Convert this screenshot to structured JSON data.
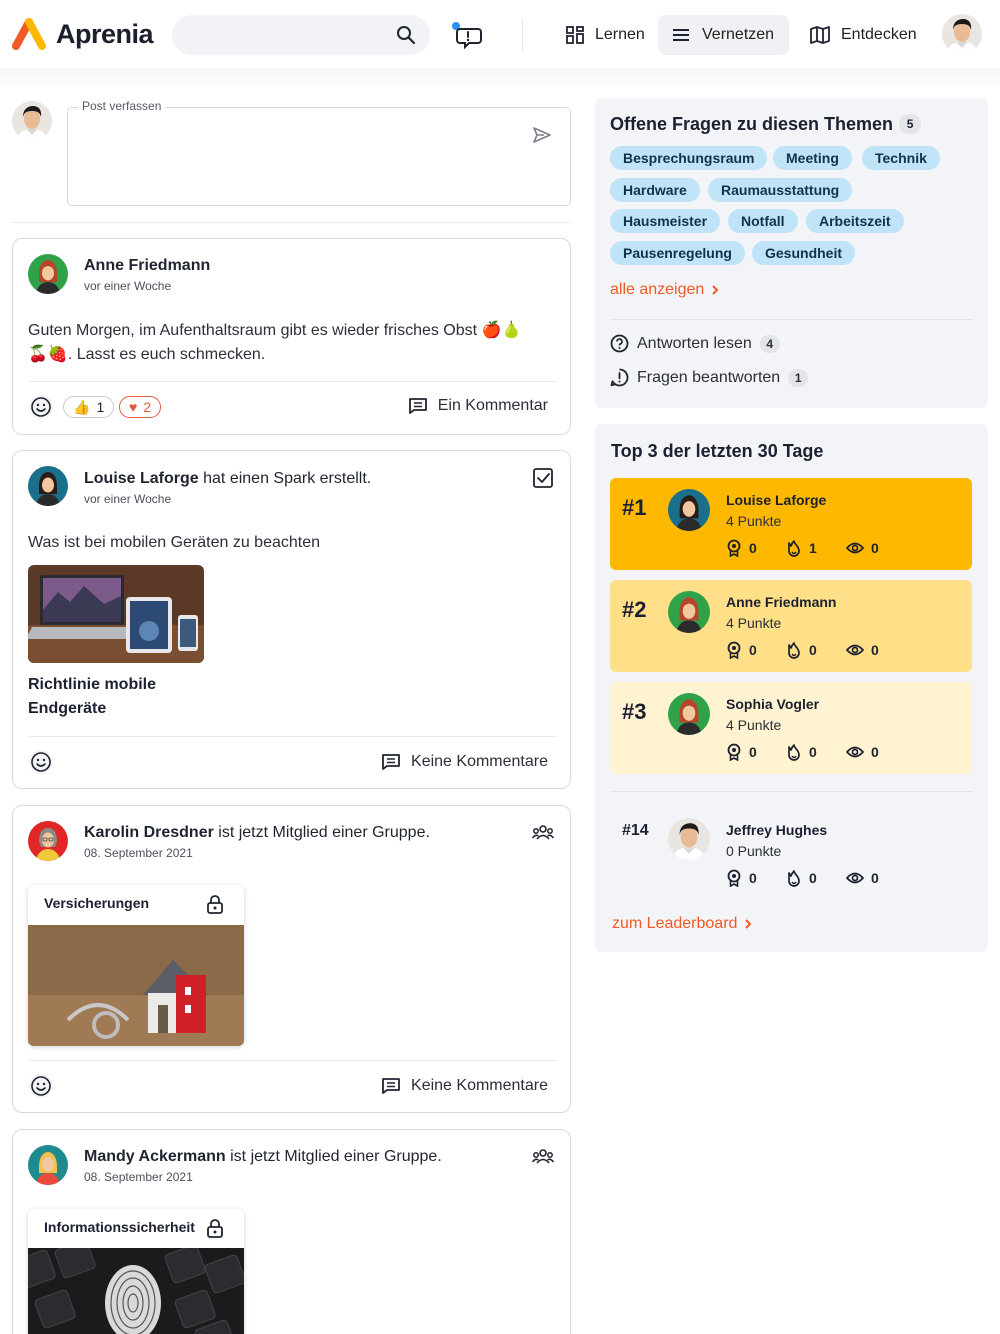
{
  "header": {
    "logo_text": "Aprenia",
    "search_placeholder": "",
    "nav": [
      {
        "label": "Lernen",
        "icon": "grid-icon",
        "active": false
      },
      {
        "label": "Vernetzen",
        "icon": "list-icon",
        "active": true
      },
      {
        "label": "Entdecken",
        "icon": "map-icon",
        "active": false
      }
    ]
  },
  "compose": {
    "label": "Post verfassen"
  },
  "posts": [
    {
      "name": "Anne Friedmann",
      "action": "",
      "time": "vor einer Woche",
      "text_line1": "Guten Morgen, im Aufenthaltsraum gibt es wieder frisches Obst 🍎🍐",
      "text_line2": "🍒🍓. Lasst es euch schmecken.",
      "reaction_thumbs": "👍",
      "reaction_thumbs_count": "1",
      "reaction_heart": "♥",
      "reaction_heart_count": "2",
      "comments": "Ein Kommentar"
    },
    {
      "name": "Louise Laforge",
      "action": " hat einen Spark erstellt.",
      "time": "vor einer Woche",
      "text": "Was ist bei mobilen Geräten zu beachten",
      "spark_title_line1": "Richtlinie mobile",
      "spark_title_line2": "Endgeräte",
      "comments": "Keine Kommentare"
    },
    {
      "name": "Karolin Dresdner",
      "action": " ist jetzt Mitglied einer Gruppe.",
      "time": "08. September 2021",
      "group": "Versicherungen",
      "comments": "Keine Kommentare"
    },
    {
      "name": "Mandy Ackermann",
      "action": " ist jetzt Mitglied einer Gruppe.",
      "time": "08. September 2021",
      "group": "Informationssicherheit"
    }
  ],
  "questions": {
    "title": "Offene Fragen zu diesen Themen",
    "count": "5",
    "tags": [
      "Besprechungsraum",
      "Meeting",
      "Technik",
      "Hardware",
      "Raumausstattung",
      "Hausmeister",
      "Notfall",
      "Arbeitszeit",
      "Pausenregelung",
      "Gesundheit"
    ],
    "show_all": "alle anzeigen",
    "read_answers": "Antworten lesen",
    "read_answers_count": "4",
    "answer_questions": "Fragen beantworten",
    "answer_questions_count": "1"
  },
  "leaderboard": {
    "title": "Top 3 der letzten 30 Tage",
    "entries": [
      {
        "rank": "#1",
        "name": "Louise Laforge",
        "points": "4 Punkte",
        "badges": "0",
        "sparks": "1",
        "views": "0",
        "bg": "#ffb800"
      },
      {
        "rank": "#2",
        "name": "Anne Friedmann",
        "points": "4 Punkte",
        "badges": "0",
        "sparks": "0",
        "views": "0",
        "bg": "#ffdf88"
      },
      {
        "rank": "#3",
        "name": "Sophia Vogler",
        "points": "4 Punkte",
        "badges": "0",
        "sparks": "0",
        "views": "0",
        "bg": "#fff3d2"
      }
    ],
    "me": {
      "rank": "#14",
      "name": "Jeffrey Hughes",
      "points": "0 Punkte",
      "badges": "0",
      "sparks": "0",
      "views": "0"
    },
    "link": "zum Leaderboard"
  },
  "colors": {
    "accent": "#f05a24",
    "tag_bg": "#bfe4f8",
    "gold": "#ffb800"
  }
}
